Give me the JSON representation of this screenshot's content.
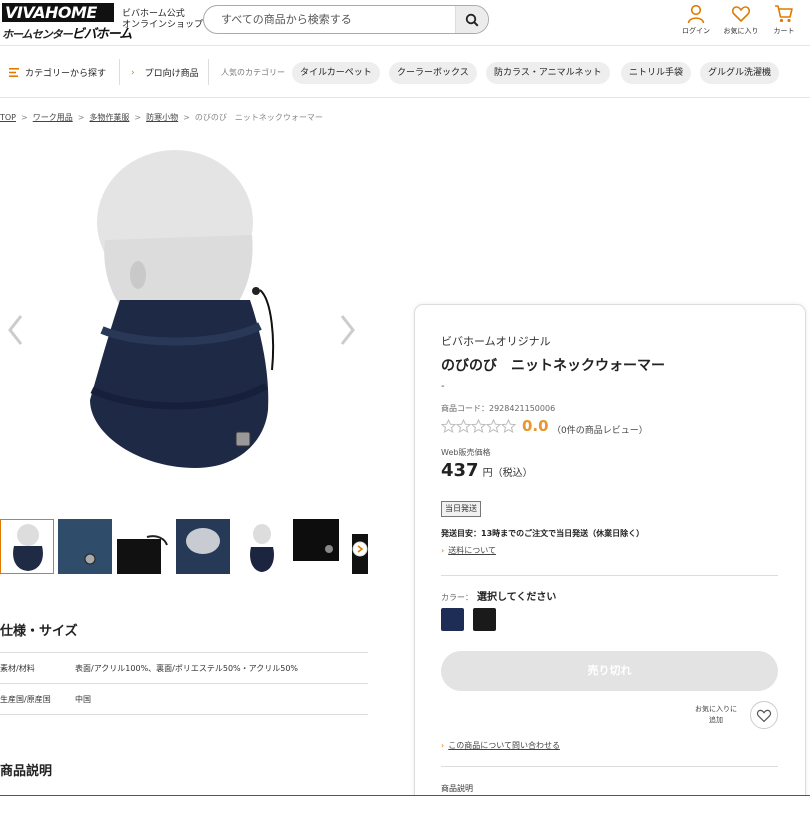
{
  "header": {
    "logo_top": "VIVAHOME",
    "logo_bottom_left": "ホームセンター",
    "logo_bottom_right": "ビバホーム",
    "shop_line1": "ビバホーム公式",
    "shop_line2": "オンラインショップ",
    "search_placeholder": "すべての商品から検索する",
    "login_label": "ログイン",
    "favorites_label": "お気に入り",
    "cart_label": "カート"
  },
  "nav": {
    "category_button": "カテゴリーから探す",
    "pro_button": "プロ向け商品",
    "popular_label": "人気のカテゴリー",
    "chips": [
      "タイルカーペット",
      "クーラーボックス",
      "防カラス・アニマルネット",
      "ニトリル手袋",
      "グルグル洗濯機"
    ]
  },
  "breadcrumb": {
    "items": [
      "TOP",
      "ワーク用品",
      "多物作業服",
      "防寒小物"
    ],
    "current": "のびのび　ニットネックウォーマー"
  },
  "gallery": {
    "thumb_colors": [
      "#1f2a44",
      "#2f4c6b",
      "#111111",
      "#263a58",
      "#1c2540",
      "#0d0d0d",
      "#111111"
    ]
  },
  "spec": {
    "heading": "仕様・サイズ",
    "rows": [
      {
        "key": "素材/材料",
        "value": "表面/アクリル100%、裏面/ポリエステル50%・アクリル50%"
      },
      {
        "key": "生産国/原産国",
        "value": "中国"
      }
    ],
    "description_heading": "商品説明"
  },
  "product": {
    "brand": "ビバホームオリジナル",
    "title": "のびのび　ニットネックウォーマー",
    "subtitle": "-",
    "code_label": "商品コード：",
    "code": "2928421150006",
    "rating": "0.0",
    "reviews": "（0件の商品レビュー）",
    "price_label": "Web販売価格",
    "price": "437",
    "price_unit": "円（税込）",
    "same_day_badge": "当日発送",
    "shipping_info": "発送目安：13時までのご注文で当日発送（休業日除く）",
    "shipping_link": "送料について",
    "color_label": "カラー：",
    "color_prompt": "選択してください",
    "swatches": [
      "#1d2d55",
      "#1a1a1a"
    ],
    "sold_out": "売り切れ",
    "favorite_line1": "お気に入りに",
    "favorite_line2": "追加",
    "inquiry_link": "この商品について問い合わせる",
    "description_label": "商品説明"
  },
  "colors": {
    "accent": "#e07b00",
    "rating": "#e8962f"
  }
}
